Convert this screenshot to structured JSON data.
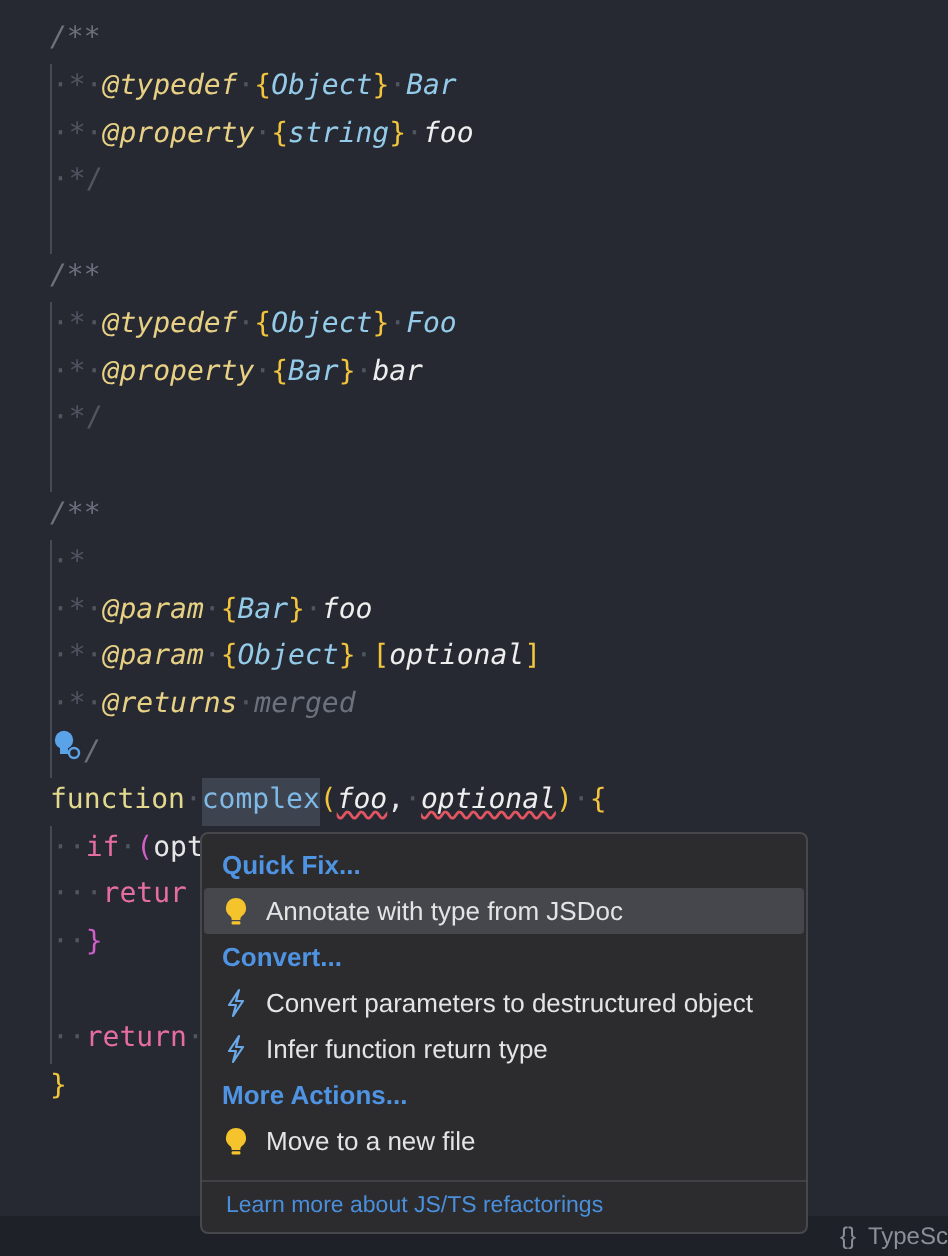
{
  "editor": {
    "lines": [
      {
        "kind": "code",
        "guide": false,
        "tokens": [
          {
            "kind": "comment",
            "text": "/**"
          }
        ]
      },
      {
        "kind": "code",
        "guide": true,
        "tokens": [
          {
            "kind": "ws",
            "text": "·*·"
          },
          {
            "kind": "tag",
            "text": "@typedef"
          },
          {
            "kind": "ws",
            "text": "·"
          },
          {
            "kind": "brace",
            "text": "{"
          },
          {
            "kind": "type",
            "text": "Object"
          },
          {
            "kind": "brace",
            "text": "}"
          },
          {
            "kind": "ws",
            "text": "·"
          },
          {
            "kind": "type",
            "text": "Bar"
          }
        ]
      },
      {
        "kind": "code",
        "guide": true,
        "tokens": [
          {
            "kind": "ws",
            "text": "·*·"
          },
          {
            "kind": "tag",
            "text": "@property"
          },
          {
            "kind": "ws",
            "text": "·"
          },
          {
            "kind": "brace",
            "text": "{"
          },
          {
            "kind": "type",
            "text": "string"
          },
          {
            "kind": "brace",
            "text": "}"
          },
          {
            "kind": "ws",
            "text": "·"
          },
          {
            "kind": "name",
            "text": "foo"
          }
        ]
      },
      {
        "kind": "code",
        "guide": true,
        "tokens": [
          {
            "kind": "ws",
            "text": "·*/"
          }
        ]
      },
      {
        "kind": "blank",
        "guide": true
      },
      {
        "kind": "code",
        "guide": false,
        "tokens": [
          {
            "kind": "comment",
            "text": "/**"
          }
        ]
      },
      {
        "kind": "code",
        "guide": true,
        "tokens": [
          {
            "kind": "ws",
            "text": "·*·"
          },
          {
            "kind": "tag",
            "text": "@typedef"
          },
          {
            "kind": "ws",
            "text": "·"
          },
          {
            "kind": "brace",
            "text": "{"
          },
          {
            "kind": "type",
            "text": "Object"
          },
          {
            "kind": "brace",
            "text": "}"
          },
          {
            "kind": "ws",
            "text": "·"
          },
          {
            "kind": "type",
            "text": "Foo"
          }
        ]
      },
      {
        "kind": "code",
        "guide": true,
        "tokens": [
          {
            "kind": "ws",
            "text": "·*·"
          },
          {
            "kind": "tag",
            "text": "@property"
          },
          {
            "kind": "ws",
            "text": "·"
          },
          {
            "kind": "brace",
            "text": "{"
          },
          {
            "kind": "type",
            "text": "Bar"
          },
          {
            "kind": "brace",
            "text": "}"
          },
          {
            "kind": "ws",
            "text": "·"
          },
          {
            "kind": "name",
            "text": "bar"
          }
        ]
      },
      {
        "kind": "code",
        "guide": true,
        "tokens": [
          {
            "kind": "ws",
            "text": "·*/"
          }
        ]
      },
      {
        "kind": "blank",
        "guide": true
      },
      {
        "kind": "code",
        "guide": false,
        "tokens": [
          {
            "kind": "comment",
            "text": "/**"
          }
        ]
      },
      {
        "kind": "code",
        "guide": true,
        "tokens": [
          {
            "kind": "ws",
            "text": "·*"
          }
        ]
      },
      {
        "kind": "code",
        "guide": true,
        "tokens": [
          {
            "kind": "ws",
            "text": "·*·"
          },
          {
            "kind": "tag",
            "text": "@param"
          },
          {
            "kind": "ws",
            "text": "·"
          },
          {
            "kind": "brace",
            "text": "{"
          },
          {
            "kind": "type",
            "text": "Bar"
          },
          {
            "kind": "brace",
            "text": "}"
          },
          {
            "kind": "ws",
            "text": "·"
          },
          {
            "kind": "name",
            "text": "foo"
          }
        ]
      },
      {
        "kind": "code",
        "guide": true,
        "tokens": [
          {
            "kind": "ws",
            "text": "·*·"
          },
          {
            "kind": "tag",
            "text": "@param"
          },
          {
            "kind": "ws",
            "text": "·"
          },
          {
            "kind": "brace",
            "text": "{"
          },
          {
            "kind": "type",
            "text": "Object"
          },
          {
            "kind": "brace",
            "text": "}"
          },
          {
            "kind": "ws",
            "text": "·"
          },
          {
            "kind": "brace",
            "text": "["
          },
          {
            "kind": "name",
            "text": "optional"
          },
          {
            "kind": "brace",
            "text": "]"
          }
        ]
      },
      {
        "kind": "code",
        "guide": true,
        "tokens": [
          {
            "kind": "ws",
            "text": "·*·"
          },
          {
            "kind": "tag",
            "text": "@returns"
          },
          {
            "kind": "ws",
            "text": "·"
          },
          {
            "kind": "comment",
            "text": "merged"
          }
        ]
      },
      {
        "kind": "code",
        "guide": true,
        "tokens": [
          {
            "kind": "bulb"
          },
          {
            "kind": "comment",
            "text": "/"
          }
        ]
      },
      {
        "kind": "code",
        "guide": false,
        "tokens": [
          {
            "kind": "decl",
            "text": "function"
          },
          {
            "kind": "ws",
            "text": "·"
          },
          {
            "kind": "func",
            "text": "complex",
            "highlight": true
          },
          {
            "kind": "brace",
            "text": "("
          },
          {
            "kind": "param",
            "text": "foo",
            "squiggle": true
          },
          {
            "kind": "plain",
            "text": ","
          },
          {
            "kind": "ws",
            "text": "·"
          },
          {
            "kind": "param",
            "text": "optional",
            "squiggle": true
          },
          {
            "kind": "brace",
            "text": ")"
          },
          {
            "kind": "ws",
            "text": "·"
          },
          {
            "kind": "brace",
            "text": "{"
          }
        ]
      },
      {
        "kind": "code",
        "guide": true,
        "tokens": [
          {
            "kind": "ws",
            "text": "··"
          },
          {
            "kind": "keyword",
            "text": "if"
          },
          {
            "kind": "ws",
            "text": "·"
          },
          {
            "kind": "paren",
            "text": "("
          },
          {
            "kind": "plain",
            "text": "opt"
          }
        ]
      },
      {
        "kind": "code",
        "guide": true,
        "tokens": [
          {
            "kind": "ws",
            "text": "···"
          },
          {
            "kind": "keyword",
            "text": "retur"
          }
        ]
      },
      {
        "kind": "code",
        "guide": true,
        "tokens": [
          {
            "kind": "ws",
            "text": "··"
          },
          {
            "kind": "paren",
            "text": "}"
          }
        ]
      },
      {
        "kind": "blank",
        "guide": true
      },
      {
        "kind": "code",
        "guide": true,
        "tokens": [
          {
            "kind": "ws",
            "text": "··"
          },
          {
            "kind": "keyword",
            "text": "return"
          },
          {
            "kind": "ws",
            "text": "·"
          }
        ]
      },
      {
        "kind": "code",
        "guide": false,
        "tokens": [
          {
            "kind": "brace",
            "text": "}"
          }
        ]
      }
    ]
  },
  "menu": {
    "items": [
      {
        "kind": "header",
        "label": "Quick Fix..."
      },
      {
        "kind": "fix",
        "label": "Annotate with type from JSDoc",
        "selected": true
      },
      {
        "kind": "header",
        "label": "Convert..."
      },
      {
        "kind": "refactor",
        "label": "Convert parameters to destructured object",
        "selected": false
      },
      {
        "kind": "refactor",
        "label": "Infer function return type",
        "selected": false
      },
      {
        "kind": "header",
        "label": "More Actions..."
      },
      {
        "kind": "fix",
        "label": "Move to a new file",
        "selected": false
      }
    ],
    "footer_link": "Learn more about JS/TS refactorings"
  },
  "status_bar": {
    "braces": "{}",
    "language": "TypeSc"
  }
}
